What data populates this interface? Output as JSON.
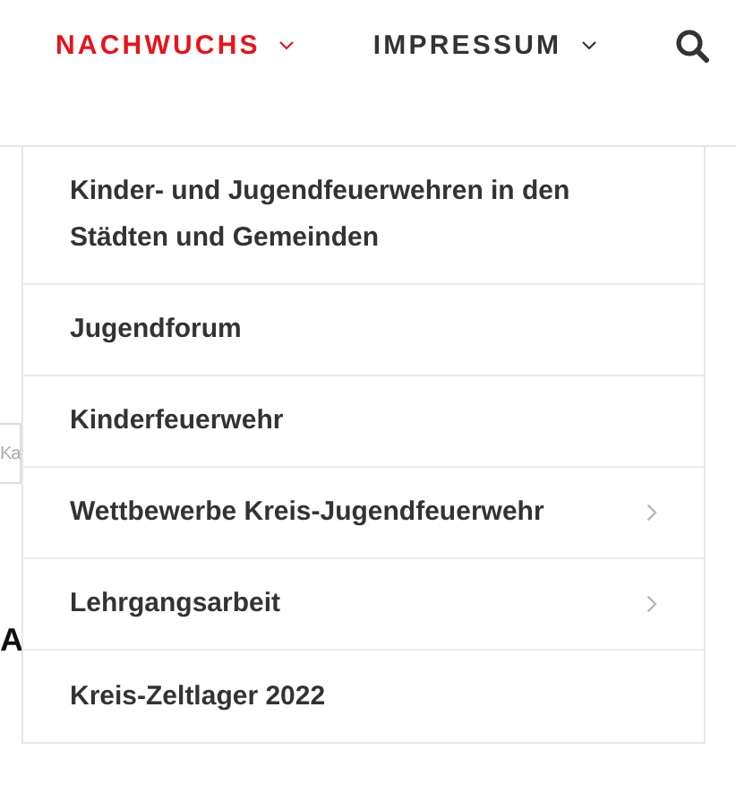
{
  "nav": [
    {
      "label": "NACHWUCHS",
      "selected": true
    },
    {
      "label": "IMPRESSUM",
      "selected": false
    }
  ],
  "dropdown": {
    "items": [
      {
        "label": "Kinder- und Jugendfeuerwehren in den Städten und Gemeinden",
        "has_submenu": false
      },
      {
        "label": "Jugendforum",
        "has_submenu": false
      },
      {
        "label": "Kinderfeuerwehr",
        "has_submenu": false
      },
      {
        "label": "Wettbewerbe Kreis-Jugendfeuerwehr",
        "has_submenu": true
      },
      {
        "label": "Lehrgangsarbeit",
        "has_submenu": true
      },
      {
        "label": "Kreis-Zeltlager 2022",
        "has_submenu": false
      }
    ]
  },
  "page": {
    "search_placeholder": "Ka",
    "heading_fragment": "A"
  }
}
